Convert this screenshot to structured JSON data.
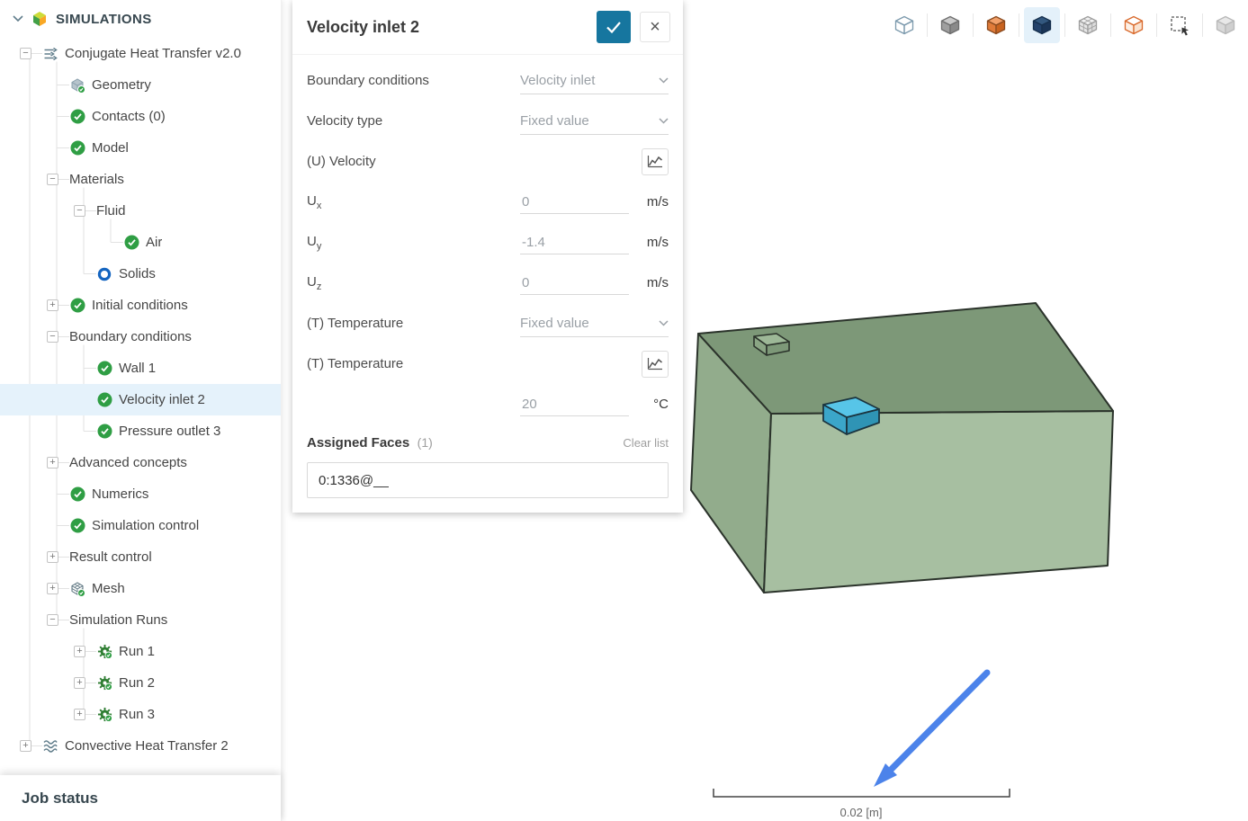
{
  "colors": {
    "accent": "#16769f",
    "selected_row": "#e5f2fb",
    "check_green": "#2f9e44",
    "solids_blue": "#1565c0",
    "arrow_blue": "#4c83ea"
  },
  "sidebar": {
    "header_label": "SIMULATIONS",
    "job_status": "Job status",
    "tree": [
      {
        "label": "Conjugate Heat Transfer v2.0",
        "level": 0,
        "expander": "minus",
        "icon": "sim"
      },
      {
        "label": "Geometry",
        "level": 1,
        "expander": "",
        "icon": "geometry"
      },
      {
        "label": "Contacts (0)",
        "level": 1,
        "expander": "",
        "icon": "check"
      },
      {
        "label": "Model",
        "level": 1,
        "expander": "",
        "icon": "check"
      },
      {
        "label": "Materials",
        "level": 1,
        "expander": "minus",
        "icon": ""
      },
      {
        "label": "Fluid",
        "level": 2,
        "expander": "minus",
        "icon": ""
      },
      {
        "label": "Air",
        "level": 3,
        "expander": "",
        "icon": "check"
      },
      {
        "label": "Solids",
        "level": 2,
        "expander": "",
        "icon": "solids"
      },
      {
        "label": "Initial conditions",
        "level": 1,
        "expander": "plus",
        "icon": "check"
      },
      {
        "label": "Boundary conditions",
        "level": 1,
        "expander": "minus",
        "icon": ""
      },
      {
        "label": "Wall 1",
        "level": 2,
        "expander": "",
        "icon": "check"
      },
      {
        "label": "Velocity inlet 2",
        "level": 2,
        "expander": "",
        "icon": "check",
        "selected": true
      },
      {
        "label": "Pressure outlet 3",
        "level": 2,
        "expander": "",
        "icon": "check"
      },
      {
        "label": "Advanced concepts",
        "level": 1,
        "expander": "plus",
        "icon": ""
      },
      {
        "label": "Numerics",
        "level": 1,
        "expander": "",
        "icon": "check"
      },
      {
        "label": "Simulation control",
        "level": 1,
        "expander": "",
        "icon": "check"
      },
      {
        "label": "Result control",
        "level": 1,
        "expander": "plus",
        "icon": ""
      },
      {
        "label": "Mesh",
        "level": 1,
        "expander": "plus",
        "icon": "mesh"
      },
      {
        "label": "Simulation Runs",
        "level": 1,
        "expander": "minus",
        "icon": ""
      },
      {
        "label": "Run 1",
        "level": 2,
        "expander": "plus",
        "icon": "gear"
      },
      {
        "label": "Run 2",
        "level": 2,
        "expander": "plus",
        "icon": "gear"
      },
      {
        "label": "Run 3",
        "level": 2,
        "expander": "plus",
        "icon": "gear"
      },
      {
        "label": "Convective Heat Transfer 2",
        "level": 0,
        "expander": "plus",
        "icon": "sim2"
      }
    ]
  },
  "panel": {
    "title": "Velocity inlet 2",
    "rows": [
      {
        "type": "select",
        "label": "Boundary conditions",
        "value": "Velocity inlet"
      },
      {
        "type": "select",
        "label": "Velocity type",
        "value": "Fixed value"
      },
      {
        "type": "chart",
        "label": "(U) Velocity"
      },
      {
        "type": "input",
        "label": "U",
        "sub": "x",
        "value": "0",
        "unit": "m/s"
      },
      {
        "type": "input",
        "label": "U",
        "sub": "y",
        "value": "-1.4",
        "unit": "m/s"
      },
      {
        "type": "input",
        "label": "U",
        "sub": "z",
        "value": "0",
        "unit": "m/s"
      },
      {
        "type": "select",
        "label": "(T) Temperature",
        "value": "Fixed value"
      },
      {
        "type": "chart",
        "label": "(T) Temperature"
      },
      {
        "type": "input",
        "label": "",
        "sub": "",
        "value": "20",
        "unit": "°C"
      }
    ],
    "assigned": {
      "label": "Assigned Faces",
      "count": "(1)",
      "clear": "Clear list",
      "value": "0:1336@__"
    }
  },
  "toolbar": {
    "icons": [
      {
        "name": "view-cube-outline"
      },
      {
        "name": "view-cube-gray"
      },
      {
        "name": "view-cube-orange"
      },
      {
        "name": "view-cube-blue",
        "active": true
      },
      {
        "name": "view-cube-mesh"
      },
      {
        "name": "view-cube-orange-outline"
      },
      {
        "name": "box-select"
      },
      {
        "name": "view-cube-disabled",
        "disabled": true
      }
    ]
  },
  "viewport": {
    "scale_label": "0.02 [m]",
    "colors": {
      "box_top": "#7d9878",
      "box_front": "#a7bfa1",
      "box_left": "#92ac8c",
      "nub_top": "#9db897",
      "nub_front": "#8aa584",
      "nub_right": "#7d9878",
      "inlet_top": "#57c5e8",
      "inlet_left": "#3ba6c9",
      "inlet_right": "#2f94b5",
      "arrow": "#4c83ea"
    }
  }
}
